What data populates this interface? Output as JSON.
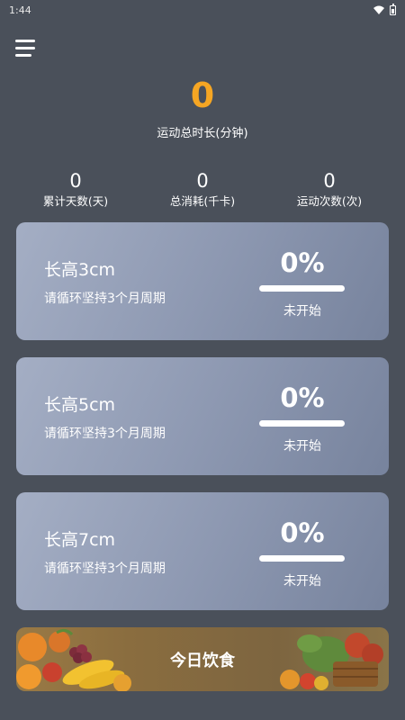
{
  "status_bar": {
    "time": "1:44",
    "icons": [
      "wifi-icon",
      "battery-icon"
    ]
  },
  "header": {
    "menu_icon": "menu-icon"
  },
  "summary": {
    "total_duration_value": "0",
    "total_duration_label": "运动总时长(分钟)",
    "accent_color": "#f6a623"
  },
  "stats": [
    {
      "value": "0",
      "label": "累计天数(天)"
    },
    {
      "value": "0",
      "label": "总消耗(千卡)"
    },
    {
      "value": "0",
      "label": "运动次数(次)"
    }
  ],
  "goals": [
    {
      "title": "长高3cm",
      "subtitle": "请循环坚持3个月周期",
      "percent": "0%",
      "progress": 0,
      "status": "未开始"
    },
    {
      "title": "长高5cm",
      "subtitle": "请循环坚持3个月周期",
      "percent": "0%",
      "progress": 0,
      "status": "未开始"
    },
    {
      "title": "长高7cm",
      "subtitle": "请循环坚持3个月周期",
      "percent": "0%",
      "progress": 0,
      "status": "未开始"
    }
  ],
  "diet_banner": {
    "label": "今日饮食"
  }
}
